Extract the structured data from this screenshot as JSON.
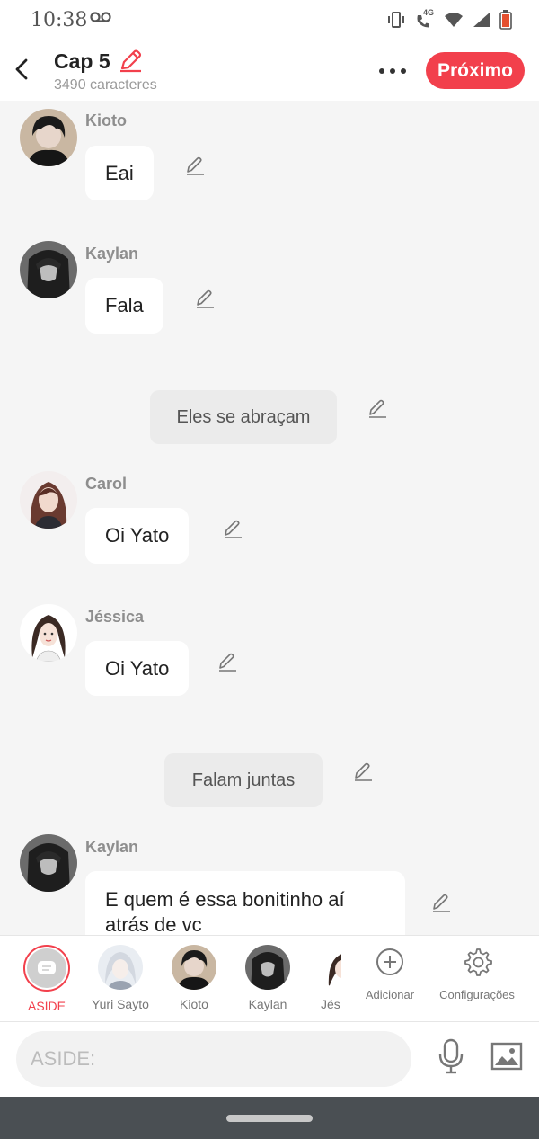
{
  "status": {
    "time": "10:38",
    "network": "4G"
  },
  "header": {
    "title": "Cap 5",
    "subtitle": "3490 caracteres",
    "next_label": "Próximo"
  },
  "messages": [
    {
      "type": "dialog",
      "name": "Kioto",
      "text": "Eai"
    },
    {
      "type": "dialog",
      "name": "Kaylan",
      "text": "Fala"
    },
    {
      "type": "narration",
      "text": "Eles se abraçam"
    },
    {
      "type": "dialog",
      "name": "Carol",
      "text": "Oi Yato"
    },
    {
      "type": "dialog",
      "name": "Jéssica",
      "text": "Oi Yato"
    },
    {
      "type": "narration",
      "text": "Falam juntas"
    },
    {
      "type": "dialog",
      "name": "Kaylan",
      "text": "E quem é essa bonitinho aí atrás de vc"
    }
  ],
  "characters": [
    {
      "label": "ASIDE",
      "selected": true
    },
    {
      "label": "Yuri Sayto"
    },
    {
      "label": "Kioto"
    },
    {
      "label": "Kaylan"
    },
    {
      "label": "Jés"
    }
  ],
  "actions": {
    "add_label": "Adicionar",
    "settings_label": "Configurações"
  },
  "input": {
    "placeholder": "ASIDE:"
  },
  "colors": {
    "accent": "#f2404c",
    "background": "#f5f5f5",
    "bubble": "#ffffff",
    "narration": "#ebebeb"
  }
}
